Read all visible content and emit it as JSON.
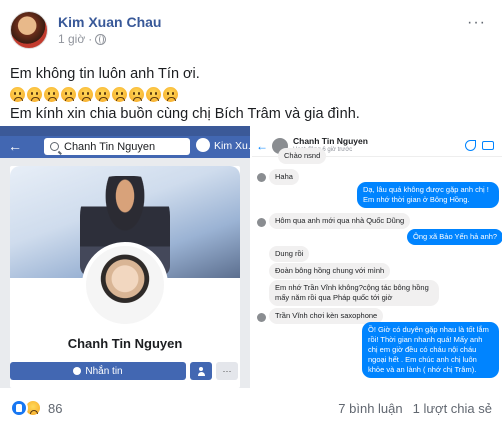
{
  "post": {
    "author": "Kim Xuan Chau",
    "time": "1 giờ",
    "privacy_icon": "globe-icon",
    "text_line1": "Em không tin luôn anh Tín ơi.",
    "emoji_count": 10,
    "emoji_icon": "sad-face-emoji",
    "text_line3": "Em kính xin chia buồn cùng chị Bích Trâm và gia đình."
  },
  "left_screenshot": {
    "search_text": "Chanh Tin Nguyen",
    "user_chip": "Kim Xu...",
    "profile_name": "Chanh Tin Nguyen",
    "message_button": "Nhắn tin",
    "more_label": "···"
  },
  "right_screenshot": {
    "chat_title": "Chanh Tin Nguyen",
    "chat_subtitle": "Hoạt động 6 giờ trước",
    "messages": {
      "m0": "Chào nsnd",
      "m1": "Haha",
      "m2": "Dạ, lâu quá không được gặp anh chị ! Em nhớ thời gian ở Bông Hồng.",
      "m3": "Hôm qua anh mới qua nhà Quốc Dũng",
      "m4": "Ông xã Bảo Yến hả anh?",
      "m5": "Dung rồi",
      "m6": "Đoàn bông hồng chung với mình",
      "m7": "Em nhớ Trần Vĩnh không?cộng tác bông hồng mấy năm rồi qua Pháp quốc tới giờ",
      "m8": "Trần Vĩnh chơi kèn saxophone",
      "m9": "Ồ! Giờ có duyên gặp nhau là tốt lắm rồi! Thời gian nhanh quá! Mấy anh chị em giờ đều có cháu nội cháu ngoại hết . Em chúc anh chị luôn khỏe và an lành ( nhớ chị Trâm)."
    }
  },
  "footer": {
    "reaction_count": "86",
    "comments": "7 bình luận",
    "shares": "1 lượt chia sẻ"
  },
  "colors": {
    "facebook_blue": "#4267b2",
    "messenger_blue": "#0084ff",
    "name_link": "#385898"
  }
}
